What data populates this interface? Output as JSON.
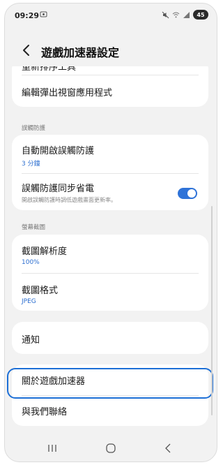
{
  "status_bar": {
    "time": "09:29",
    "notification_icon": "screen-record-icon",
    "battery": "45",
    "icons": [
      "mute-icon",
      "wifi-icon",
      "signal-icon"
    ]
  },
  "header": {
    "title": "遊戲加速器設定",
    "back_icon": "back-arrow-icon"
  },
  "group1": {
    "partial_item": "重新排序工具",
    "item": "編輯彈出視窗應用程式"
  },
  "section_touch": {
    "header": "誤觸防護",
    "auto_enable": {
      "label": "自動開啟誤觸防護",
      "value": "3 分鐘"
    },
    "power_sync": {
      "label": "誤觸防護同步省電",
      "description": "開啟誤觸防護時調低遊戲畫面更新率。",
      "enabled": true
    }
  },
  "section_screenshot": {
    "header": "螢幕截圖",
    "resolution": {
      "label": "截圖解析度",
      "value": "100%"
    },
    "format": {
      "label": "截圖格式",
      "value": "JPEG"
    }
  },
  "notifications": {
    "label": "通知"
  },
  "about_group": {
    "about": "關於遊戲加速器",
    "contact": "與我們聯絡"
  },
  "colors": {
    "accent": "#2f73d8",
    "highlight": "#1d6fd6"
  },
  "navigation": [
    "recent-apps-icon",
    "home-icon",
    "back-icon"
  ]
}
